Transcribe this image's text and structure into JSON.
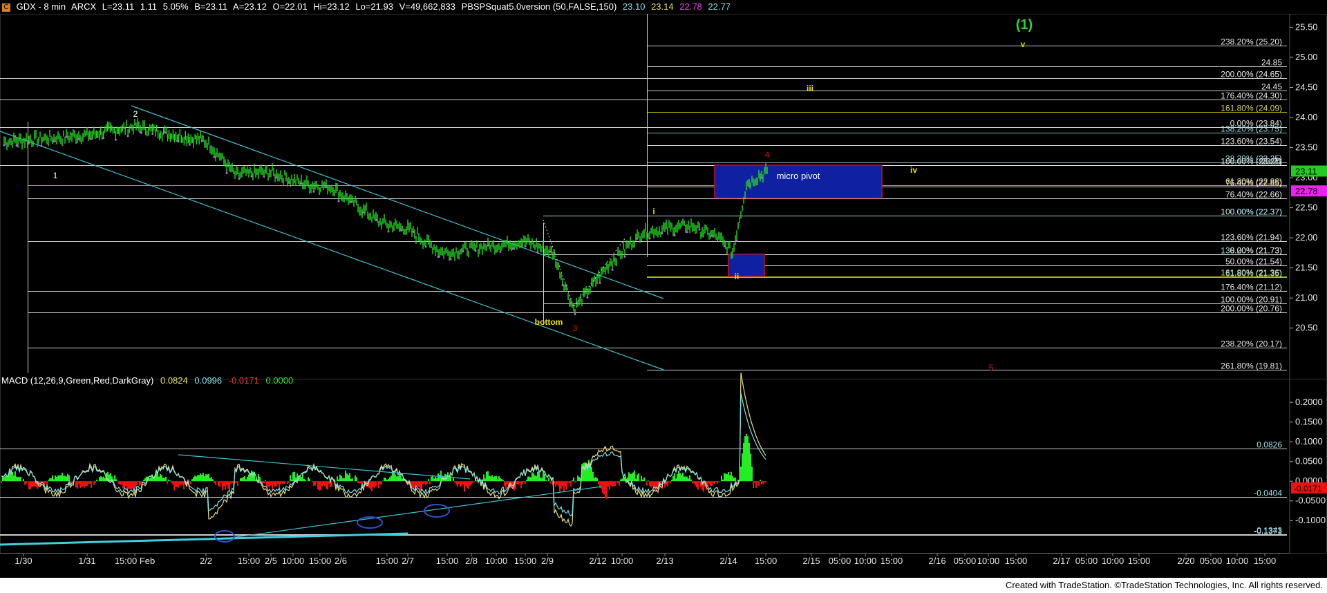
{
  "header": {
    "icon": "C",
    "symbol": "GDX - 8 min",
    "exchange": "ARCX",
    "last": "L=23.11",
    "change": "1.11",
    "pct": "5.05%",
    "bid": "B=23.11",
    "ask": "A=23.12",
    "open": "O=22.01",
    "hi": "Hi=23.12",
    "lo": "Lo=21.93",
    "volume": "V=49,662,833",
    "study": "PBSPSquat5.0version (50,FALSE,150)",
    "v1": "23.10",
    "v2": "23.14",
    "v3": "22.78",
    "v4": "22.77"
  },
  "colors": {
    "background": "#000000",
    "price": "#22dd22",
    "fib_white": "#e8e8e8",
    "fib_yellow": "#c8c000",
    "trend": "#40c0d0",
    "box_fill": "#0f21a0",
    "box_border": "#c01030",
    "wave_red": "#e01010",
    "wave_yellow": "#e8e000",
    "wave_white": "#ffffff",
    "macd_green": "#22ee22",
    "macd_red": "#ee1111",
    "macd_fast": "#e8e080",
    "macd_slow": "#7fe0e8",
    "last_tag": "#22cc22",
    "magenta_tag": "#ee22ee"
  },
  "macd_legend": {
    "name": "MACD (12,26,9,Green,Red,DarkGray)",
    "v1": "0.0824",
    "v2": "0.0996",
    "v3": "-0.0171",
    "v4": "0.0000"
  },
  "footer": "Created with TradeStation. ©TradeStation Technologies, Inc. All rights reserved.",
  "price_axis": {
    "ticks": [
      "25.50",
      "25.00",
      "24.50",
      "24.00",
      "23.50",
      "23.00",
      "22.50",
      "22.00",
      "21.50",
      "21.00",
      "20.50"
    ],
    "tick_values": [
      25.5,
      25.0,
      24.5,
      24.0,
      23.5,
      23.0,
      22.5,
      22.0,
      21.5,
      21.0,
      20.5
    ],
    "last_tag": "23.11",
    "last_value": 23.11,
    "magenta_tag": "22.78",
    "magenta_value": 22.78
  },
  "macd_axis": {
    "ticks": [
      "0.2000",
      "0.1500",
      "0.1000",
      "0.0500",
      "0.0000",
      "-0.0500",
      "-0.1000"
    ],
    "tick_values": [
      0.2,
      0.15,
      0.1,
      0.05,
      0.0,
      -0.05,
      -0.1
    ],
    "level_labels": [
      {
        "text": "0.0826",
        "value": 0.0826
      },
      {
        "text": "-0.0404",
        "value": -0.0404
      },
      {
        "text": "-0.1371",
        "value": -0.1371
      },
      {
        "text": "-0.1343",
        "value": -0.1343
      }
    ],
    "red_tag": "-0.0171",
    "red_value": -0.0171
  },
  "time_axis": [
    "1/30",
    "1/31",
    "15:00 Feb",
    "2/2",
    "15:00",
    "2/5",
    "10:00",
    "15:00",
    "2/6",
    "15:00",
    "2/7",
    "15:00",
    "2/8",
    "10:00",
    "15:00",
    "2/9",
    "2/12",
    "10:00",
    "2/13",
    "2/14",
    "15:00",
    "2/15",
    "05:00",
    "10:00",
    "15:00",
    "2/16",
    "05:00",
    "10:00",
    "15:00",
    "2/17",
    "05:00",
    "10:00",
    "15:00",
    "2/20",
    "05:00",
    "10:00",
    "15:00"
  ],
  "chart_data": {
    "type": "line",
    "title": "GDX - 8 min",
    "xlabel": "",
    "ylabel": "",
    "ylim": [
      19.75,
      25.7
    ],
    "approx_close_path": [
      {
        "x": "1/30",
        "y": 23.6
      },
      {
        "x": "1/31",
        "y": 23.7
      },
      {
        "x": "15:00 Feb",
        "y": 23.85
      },
      {
        "x": "2/2",
        "y": 23.6
      },
      {
        "x": "2/2 15:00",
        "y": 23.05
      },
      {
        "x": "2/5",
        "y": 23.1
      },
      {
        "x": "2/5 15:00",
        "y": 22.9
      },
      {
        "x": "2/6",
        "y": 22.85
      },
      {
        "x": "2/6 15:00",
        "y": 22.25
      },
      {
        "x": "2/7",
        "y": 22.15
      },
      {
        "x": "2/7 15:00",
        "y": 21.75
      },
      {
        "x": "2/8",
        "y": 21.85
      },
      {
        "x": "2/8 15:00",
        "y": 21.95
      },
      {
        "x": "2/9",
        "y": 21.75
      },
      {
        "x": "2/9 bottom",
        "y": 20.82
      },
      {
        "x": "2/12",
        "y": 21.55
      },
      {
        "x": "2/12 10:00",
        "y": 22.1
      },
      {
        "x": "2/13",
        "y": 22.2
      },
      {
        "x": "2/13 late",
        "y": 22.0
      },
      {
        "x": "2/14",
        "y": 21.75
      },
      {
        "x": "2/14 mid",
        "y": 22.9
      },
      {
        "x": "2/14 15:00",
        "y": 23.11
      }
    ],
    "fib_levels": [
      {
        "label": "238.20% (25.20)",
        "value": 25.2
      },
      {
        "label": "24.85",
        "value": 24.85
      },
      {
        "label": "200.00% (24.65)",
        "value": 24.65
      },
      {
        "label": "24.45",
        "value": 24.45
      },
      {
        "label": "176.40% (24.30)",
        "value": 24.3
      },
      {
        "label": "161.80% (24.09)",
        "value": 24.09
      },
      {
        "label": "0.00% (23.84)",
        "value": 23.84
      },
      {
        "label": "138.20% (23.75)",
        "value": 23.75
      },
      {
        "label": "123.60% (23.54)",
        "value": 23.54
      },
      {
        "label": "38.20% (23.25)",
        "value": 23.25
      },
      {
        "label": "100.00% (23.21)",
        "value": 23.21
      },
      {
        "label": "23.21",
        "value": 23.21
      },
      {
        "label": "61.80% (22.88)",
        "value": 22.88
      },
      {
        "label": "76.40% (22.85)",
        "value": 22.85
      },
      {
        "label": "76.40% (22.66)",
        "value": 22.66
      },
      {
        "label": "100.00% (22.37)",
        "value": 22.37
      },
      {
        "label": "0.00% (22.37)",
        "value": 22.37
      },
      {
        "label": "123.60% (21.94)",
        "value": 21.94
      },
      {
        "label": "138.20% (21.73)",
        "value": 21.73
      },
      {
        "label": "0.00% (21.73)",
        "value": 21.73
      },
      {
        "label": "50.00% (21.54)",
        "value": 21.54
      },
      {
        "label": "161.80% (21.36)",
        "value": 21.36
      },
      {
        "label": "61.80% (21.35)",
        "value": 21.35
      },
      {
        "label": "176.40% (21.12)",
        "value": 21.12
      },
      {
        "label": "100.00% (20.91)",
        "value": 20.91
      },
      {
        "label": "200.00% (20.76)",
        "value": 20.76
      },
      {
        "label": "238.20% (20.17)",
        "value": 20.17
      },
      {
        "label": "261.80% (19.81)",
        "value": 19.81
      }
    ],
    "annotations": [
      {
        "text": "(1)",
        "color": "green"
      },
      {
        "text": "v",
        "color": "yellow"
      },
      {
        "text": "iii",
        "color": "yellow"
      },
      {
        "text": "iv",
        "color": "yellow"
      },
      {
        "text": "i",
        "color": "yellow"
      },
      {
        "text": "ii",
        "color": "yellow"
      },
      {
        "text": "1",
        "color": "white"
      },
      {
        "text": "2",
        "color": "white"
      },
      {
        "text": "3",
        "color": "red"
      },
      {
        "text": "4",
        "color": "red"
      },
      {
        "text": "5",
        "color": "red"
      },
      {
        "text": "bottom",
        "color": "yellow"
      },
      {
        "text": "micro pivot",
        "color": "white"
      }
    ],
    "boxes": [
      {
        "label": "micro pivot",
        "high": 23.21,
        "low": 22.66
      },
      {
        "label": "",
        "high": 21.73,
        "low": 21.36
      }
    ],
    "macd": {
      "name": "MACD (12,26,9,Green,Red,DarkGray)",
      "ylim": [
        -0.175,
        0.26
      ],
      "values_shown": [
        0.0824,
        0.0996,
        -0.0171,
        0.0
      ]
    }
  }
}
